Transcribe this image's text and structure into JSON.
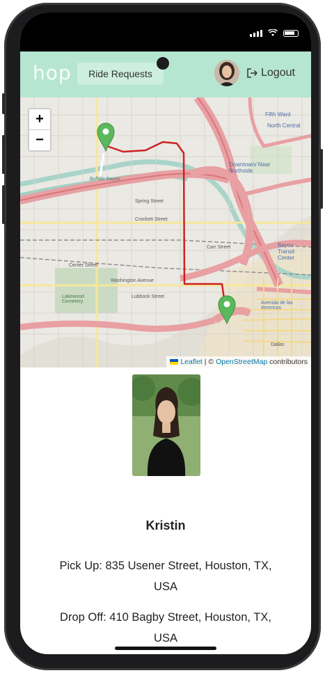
{
  "app": {
    "logo": "hop"
  },
  "nav": {
    "tab_label": "Ride Requests",
    "logout_label": "Logout"
  },
  "map": {
    "zoom_in": "+",
    "zoom_out": "−",
    "labels": {
      "fifth_ward": "Fifth Ward",
      "north_central": "North Central",
      "downtown": "Downtown/ Near Northside",
      "spring": "Spring Street",
      "crockett": "Crockett Street",
      "carr": "Carr Street",
      "center": "Center Street",
      "washington": "Washington Avenue",
      "lubbock": "Lubbock Street",
      "lakewood": "Lakewood Cemetery",
      "buffalo": "Buffalo Bayou",
      "bayou_transit": "Bayou Transit Center",
      "avenida": "Avenida de las Americas",
      "dallas": "Dallas"
    },
    "attribution": {
      "leaflet": "Leaflet",
      "separator": " | © ",
      "osm": "OpenStreetMap",
      "suffix": " contributors"
    },
    "route_color": "#cc2222",
    "marker_color": "#5bb85d"
  },
  "ride": {
    "driver_name": "Kristin",
    "pickup": "Pick Up: 835 Usener Street, Houston, TX, USA",
    "dropoff": "Drop Off: 410 Bagby Street, Houston, TX, USA"
  }
}
